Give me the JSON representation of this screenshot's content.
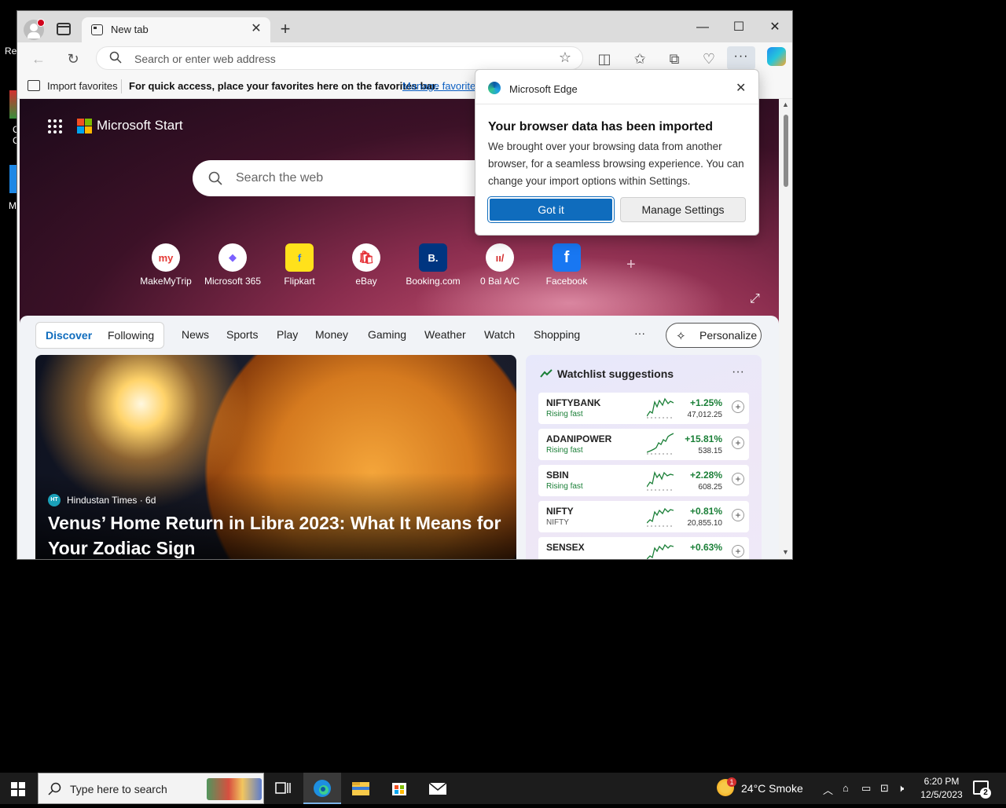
{
  "desktop": {
    "fragments": [
      "Re",
      "C",
      "C",
      "M"
    ]
  },
  "browser": {
    "tab_title": "New tab",
    "tab_close": "✕",
    "new_tab": "+",
    "window_controls": {
      "minimize": "—",
      "maximize": "☐",
      "close": "✕"
    },
    "address_placeholder": "Search or enter web address",
    "more": "···",
    "favbar": {
      "import": "Import favorites",
      "quick_access": "For quick access, place your favorites here on the favorites bar.",
      "manage": "Manage favorites"
    }
  },
  "newtab": {
    "brand": "Microsoft Start",
    "search_placeholder": "Search the web",
    "quick_links": [
      {
        "label": "MakeMyTrip",
        "glyph": "my",
        "color": "#e53935"
      },
      {
        "label": "Microsoft 365",
        "glyph": "◆",
        "color": "#7b61ff"
      },
      {
        "label": "Flipkart",
        "glyph": "f",
        "color": "#2874f0"
      },
      {
        "label": "eBay",
        "glyph": "🛍",
        "color": "#e53238"
      },
      {
        "label": "Booking.com",
        "glyph": "B.",
        "color": "#003580"
      },
      {
        "label": "0 Bal A/C",
        "glyph": "ıı/",
        "color": "#d32f2f"
      },
      {
        "label": "Facebook",
        "glyph": "f",
        "color": "#1877f2"
      }
    ],
    "add_link": "+",
    "expand": "⤢",
    "feed_nav": {
      "discover": "Discover",
      "following": "Following",
      "items": [
        "News",
        "Sports",
        "Play",
        "Money",
        "Gaming",
        "Weather",
        "Watch",
        "Shopping"
      ],
      "more": "···",
      "personalize": "Personalize"
    },
    "hero": {
      "source_icon_text": "HT",
      "source": "Hindustan Times · 6d",
      "headline": "Venus’ Home Return in Libra 2023: What It Means for Your Zodiac Sign"
    },
    "watchlist": {
      "title": "Watchlist suggestions",
      "more": "···",
      "stocks": [
        {
          "symbol": "NIFTYBANK",
          "sub": "Rising fast",
          "change": "+1.25%",
          "price": "47,012.25"
        },
        {
          "symbol": "ADANIPOWER",
          "sub": "Rising fast",
          "change": "+15.81%",
          "price": "538.15"
        },
        {
          "symbol": "SBIN",
          "sub": "Rising fast",
          "change": "+2.28%",
          "price": "608.25"
        },
        {
          "symbol": "NIFTY",
          "sub": "NIFTY",
          "change": "+0.81%",
          "price": "20,855.10"
        },
        {
          "symbol": "SENSEX",
          "sub": "",
          "change": "+0.63%",
          "price": ""
        }
      ]
    }
  },
  "popup": {
    "header": "Microsoft Edge",
    "title": "Your browser data has been imported",
    "body": "We brought over your browsing data from another browser, for a seamless browsing experience. You can change your import options within Settings.",
    "primary": "Got it",
    "secondary": "Manage Settings",
    "close": "✕"
  },
  "taskbar": {
    "search_placeholder": "Type here to search",
    "weather": "24°C  Smoke",
    "weather_badge": "1",
    "time": "6:20 PM",
    "date": "12/5/2023",
    "notifications": "2"
  }
}
